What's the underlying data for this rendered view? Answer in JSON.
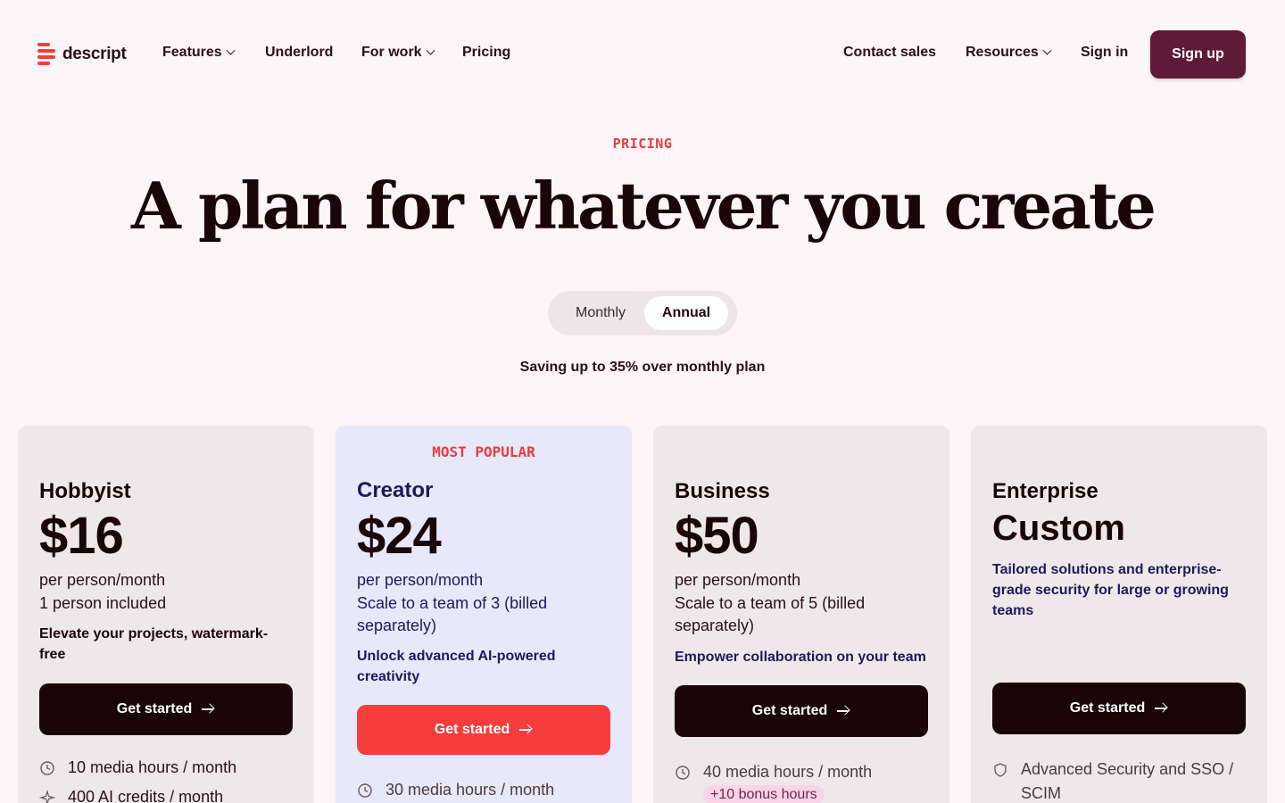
{
  "nav": {
    "logo_text": "descript",
    "links": [
      {
        "label": "Features"
      },
      {
        "label": "Underlord"
      },
      {
        "label": "For work"
      },
      {
        "label": "Pricing"
      }
    ],
    "right_links": [
      {
        "label": "Contact sales"
      },
      {
        "label": "Resources"
      },
      {
        "label": "Sign in"
      }
    ],
    "signup_label": "Sign up",
    "brand_color": "#5e1a36"
  },
  "hero": {
    "eyebrow": "PRICING",
    "title": "A plan for whatever you create",
    "toggle": {
      "monthly": "Monthly",
      "annual": "Annual",
      "selected": "Annual"
    },
    "saving_note": "Saving up to 35% over monthly plan"
  },
  "plans": [
    {
      "name": "Hobbyist",
      "price": "$16",
      "unit": "per person/month",
      "seats": "1 person included",
      "tagline": "Elevate your projects, watermark-free",
      "cta": "Get started",
      "features": [
        "10 media hours / month",
        "400 AI credits / month"
      ]
    },
    {
      "badge": "MOST POPULAR",
      "name": "Creator",
      "price": "$24",
      "unit": "per person/month",
      "seats": "Scale to a team of 3 (billed separately)",
      "tagline": "Unlock advanced AI-powered creativity",
      "cta": "Get started",
      "features": [
        "30 media hours / month"
      ]
    },
    {
      "name": "Business",
      "price": "$50",
      "unit": "per person/month",
      "seats": "Scale to a team of 5 (billed separately)",
      "tagline": "Empower collaboration on your team",
      "cta": "Get started",
      "features": [
        "40 media hours / month"
      ],
      "bonus": "+10 bonus hours"
    },
    {
      "name": "Enterprise",
      "price": "Custom",
      "tagline": "Tailored solutions and enterprise-grade security for large or growing teams",
      "cta": "Get started",
      "features": [
        "Advanced Security and SSO / SCIM"
      ]
    }
  ],
  "colors": {
    "accent_red": "#f53d3d",
    "dark": "#1a0509",
    "creator_bg": "#e8e8fb"
  }
}
